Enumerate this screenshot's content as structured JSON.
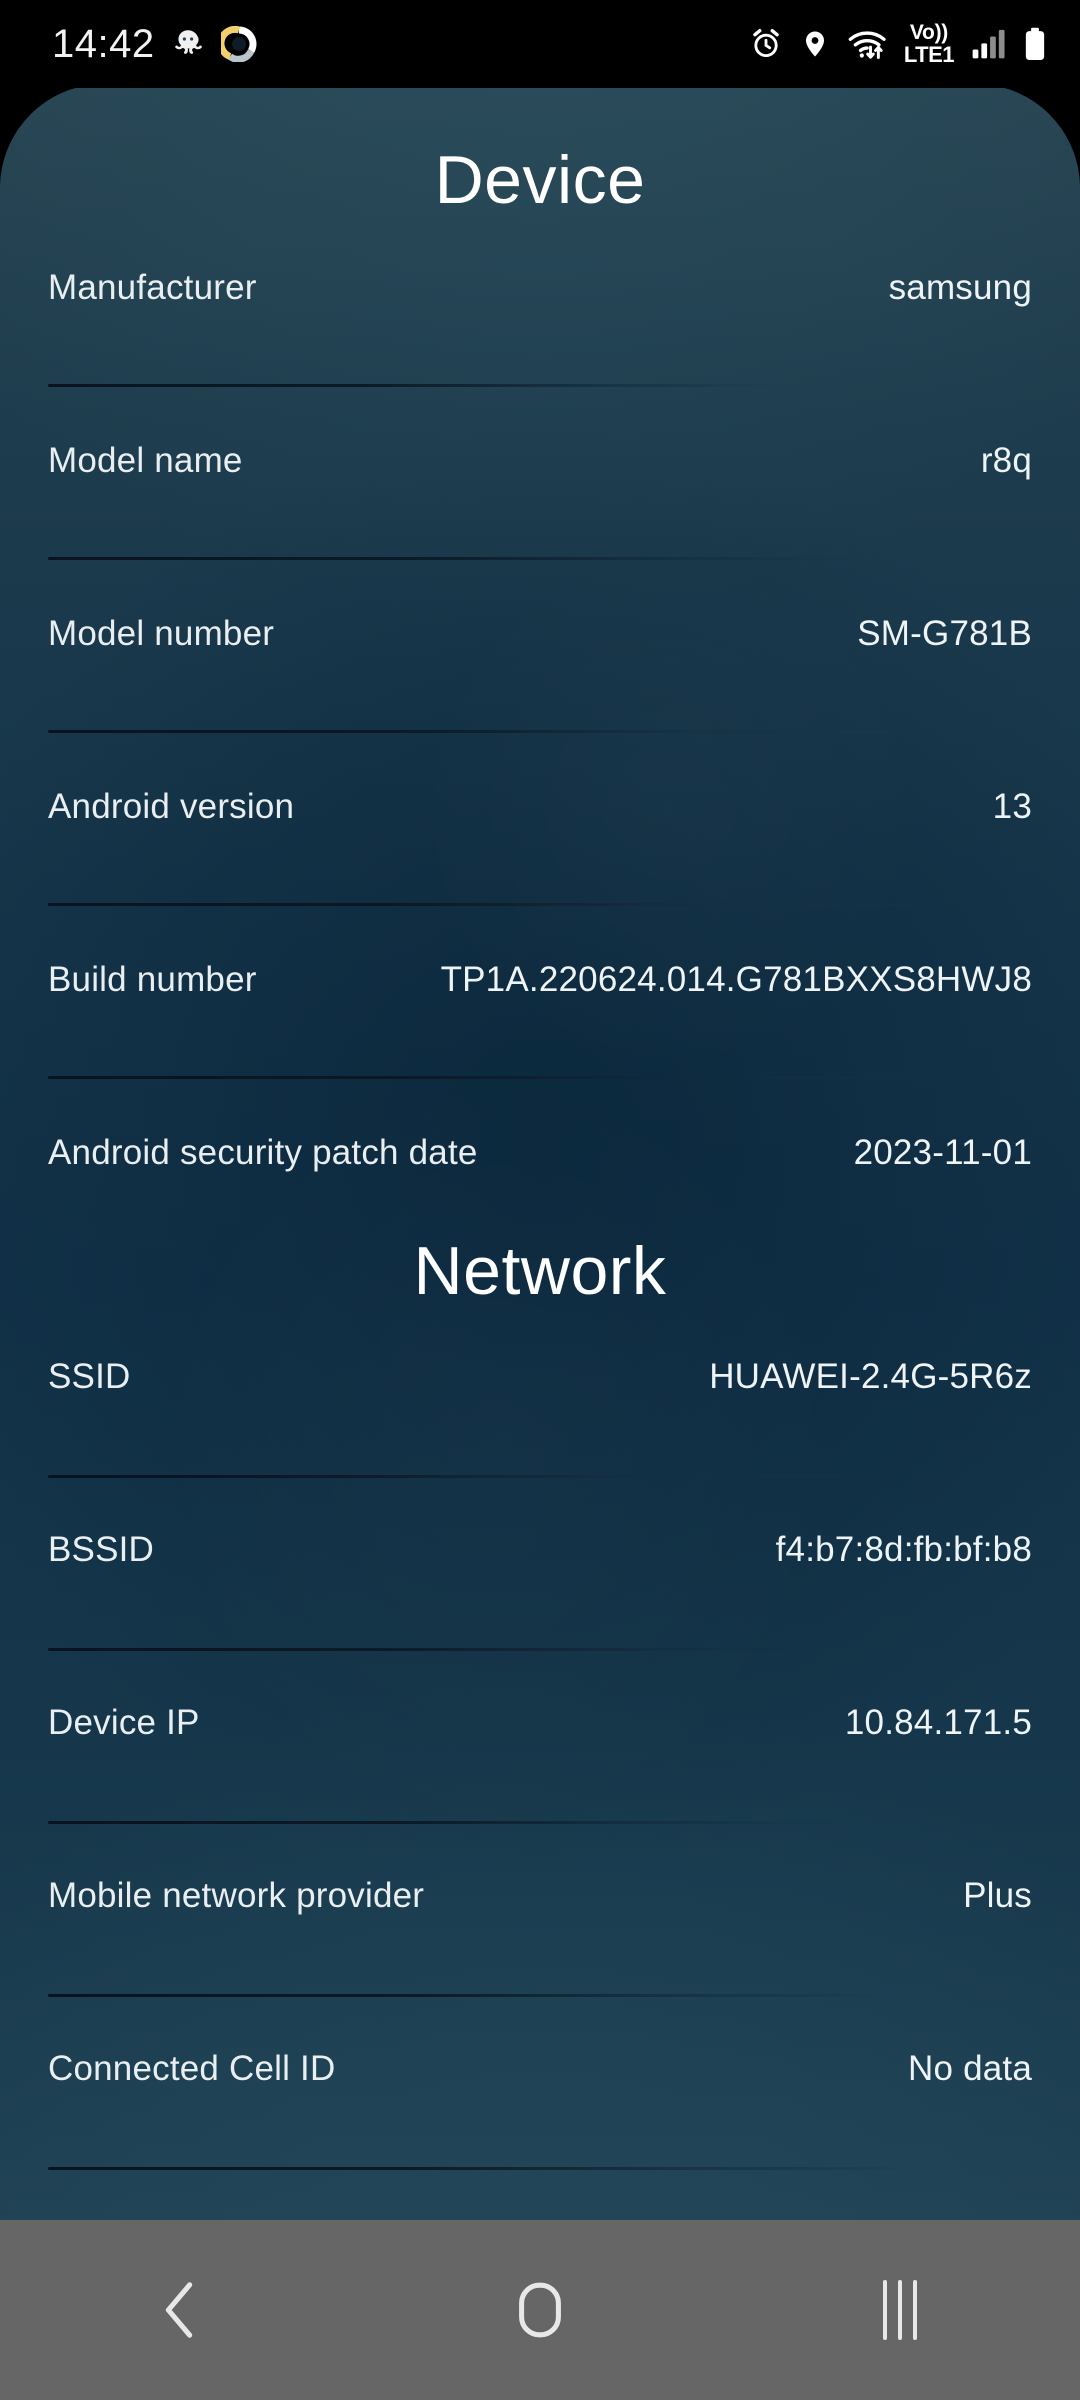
{
  "status_bar": {
    "clock": "14:42",
    "left_icons": [
      "octopus-icon",
      "orbit-ring-icon"
    ],
    "right_icons": [
      "alarm-icon",
      "location-pin-icon",
      "wifi-transfer-icon",
      "volte-icon",
      "signal-bars-icon",
      "battery-icon"
    ],
    "volte_top": "Vo))",
    "volte_bottom": "LTE1"
  },
  "sections": [
    {
      "title": "Device",
      "rows": [
        {
          "label": "Manufacturer",
          "value": "samsung"
        },
        {
          "label": "Model name",
          "value": "r8q"
        },
        {
          "label": "Model number",
          "value": "SM-G781B"
        },
        {
          "label": "Android version",
          "value": "13"
        },
        {
          "label": "Build number",
          "value": "TP1A.220624.014.G781BXXS8HWJ8"
        },
        {
          "label": "Android security patch date",
          "value": "2023-11-01"
        }
      ]
    },
    {
      "title": "Network",
      "rows": [
        {
          "label": "SSID",
          "value": "HUAWEI-2.4G-5R6z"
        },
        {
          "label": "BSSID",
          "value": "f4:b7:8d:fb:bf:b8"
        },
        {
          "label": "Device IP",
          "value": "10.84.171.5"
        },
        {
          "label": "Mobile network provider",
          "value": "Plus"
        },
        {
          "label": "Connected Cell ID",
          "value": "No data"
        }
      ]
    }
  ],
  "nav_bar": {
    "back_label": "Back",
    "home_label": "Home",
    "recents_label": "Recents"
  },
  "colors": {
    "card_top": "#27424f",
    "card_mid": "#123249",
    "card_bottom": "#1e4052",
    "text_primary": "#eef3f6",
    "status_bar_bg": "#000000",
    "nav_bar_bg": "#666666"
  }
}
